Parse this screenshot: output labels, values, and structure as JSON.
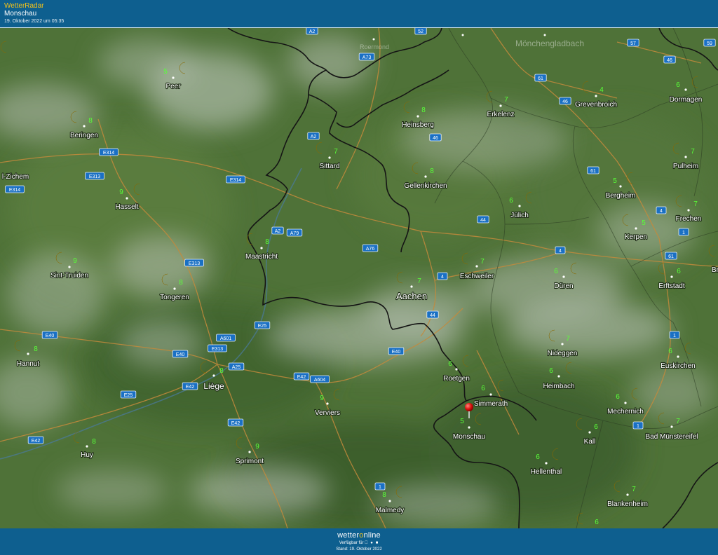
{
  "header": {
    "brand": "WetterRadar",
    "location": "Monschau",
    "timestamp": "19. Oktober 2022 um 05:35"
  },
  "footer": {
    "logo_before": "wetter",
    "logo_accent": "o",
    "logo_after": "nline",
    "availability": "Verfügbar für",
    "store_icons": [
      "apple-icon",
      "android-icon",
      "windows-icon"
    ],
    "stand": "Stand: 19. Oktober 2022"
  },
  "colors": {
    "header_bg": "#0e5f8f",
    "brand_yellow": "#f2c21a",
    "temperature_green": "#58ff38",
    "moon_yellow": "#f6d21c",
    "marker_red": "#e0120f",
    "highway_badge": "#1a70c4"
  },
  "marker": {
    "city": "Monschau",
    "icon": "location-pin-icon"
  },
  "cities": [
    {
      "name": "Peer",
      "temp": "5"
    },
    {
      "name": "Beringen",
      "temp": "8"
    },
    {
      "name": "l-Zichem",
      "temp": ""
    },
    {
      "name": "Hasselt",
      "temp": "9"
    },
    {
      "name": "Sint-Truiden",
      "temp": "9"
    },
    {
      "name": "Tongeren",
      "temp": "8"
    },
    {
      "name": "Hannut",
      "temp": "8"
    },
    {
      "name": "Huy",
      "temp": "8"
    },
    {
      "name": "Liège",
      "temp": "8"
    },
    {
      "name": "Maastricht",
      "temp": "8"
    },
    {
      "name": "Sittard",
      "temp": "7"
    },
    {
      "name": "Heinsberg",
      "temp": "8"
    },
    {
      "name": "Gellenkirchen",
      "temp": "8"
    },
    {
      "name": "Erkelenz",
      "temp": "7"
    },
    {
      "name": "Grevenbroich",
      "temp": "4"
    },
    {
      "name": "Dormagen",
      "temp": "6"
    },
    {
      "name": "Pulheim",
      "temp": "7"
    },
    {
      "name": "Bergheim",
      "temp": "5"
    },
    {
      "name": "Jülich",
      "temp": "6"
    },
    {
      "name": "Kerpen",
      "temp": "5"
    },
    {
      "name": "Frechen",
      "temp": "7"
    },
    {
      "name": "Eschweiler",
      "temp": "7"
    },
    {
      "name": "Düren",
      "temp": "6"
    },
    {
      "name": "Erftstadt",
      "temp": "6"
    },
    {
      "name": "Aachen",
      "temp": "7"
    },
    {
      "name": "Nideggen",
      "temp": "7"
    },
    {
      "name": "Euskirchen",
      "temp": "6"
    },
    {
      "name": "Roetgen",
      "temp": "6"
    },
    {
      "name": "Heimbach",
      "temp": "6"
    },
    {
      "name": "Simmerath",
      "temp": "6"
    },
    {
      "name": "Mechernich",
      "temp": "6"
    },
    {
      "name": "Monschau",
      "temp": "5"
    },
    {
      "name": "Kall",
      "temp": "6"
    },
    {
      "name": "Bad Münstereifel",
      "temp": "7"
    },
    {
      "name": "Verviers",
      "temp": "9"
    },
    {
      "name": "Sprimont",
      "temp": "9"
    },
    {
      "name": "Hellenthal",
      "temp": "6"
    },
    {
      "name": "Blankenheim",
      "temp": "7"
    },
    {
      "name": "Malmedy",
      "temp": "8"
    },
    {
      "name": "Br",
      "temp": ""
    }
  ],
  "extra_temps": [
    "6"
  ],
  "faded_labels": [
    "Roermond",
    "Mönchengladbach"
  ],
  "road_badges": [
    "A2",
    "A73",
    "52",
    "57",
    "59",
    "46",
    "61",
    "46",
    "A2",
    "46",
    "E314",
    "E313",
    "E314",
    "E314",
    "61",
    "4",
    "1",
    "A2",
    "A79",
    "A76",
    "44",
    "4",
    "4",
    "61",
    "E313",
    "1",
    "E25",
    "A601",
    "E313",
    "E40",
    "E40",
    "A25",
    "E40",
    "E42",
    "A604",
    "E42",
    "E25",
    "E42",
    "E42",
    "1",
    "1",
    "44"
  ]
}
